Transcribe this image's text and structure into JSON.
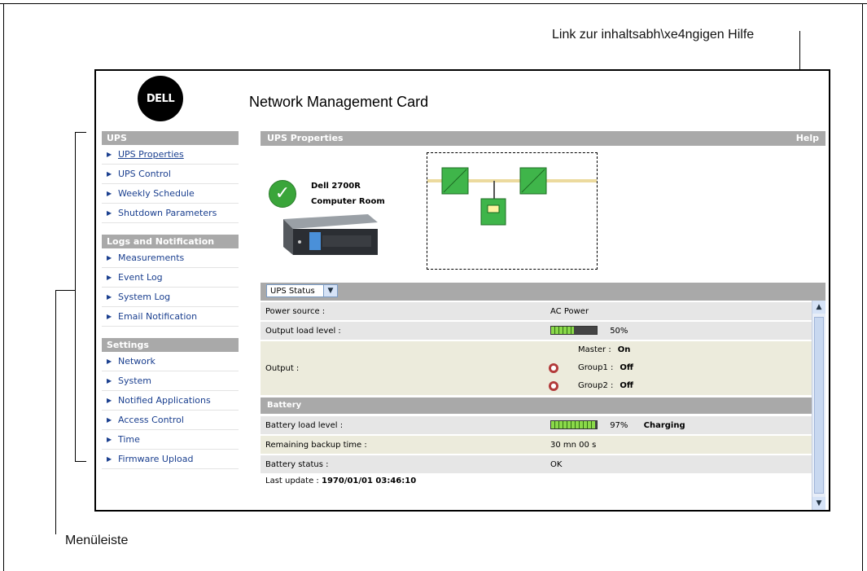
{
  "callouts": {
    "help_link": "Link zur inhaltsabh\\xe4ngigen Hilfe",
    "menu_bar": "Menüleiste"
  },
  "logo_text": "DELL",
  "header": {
    "title": "Network Management Card"
  },
  "sidebar": {
    "sections": [
      {
        "title": "UPS",
        "items": [
          "UPS Properties",
          "UPS Control",
          "Weekly Schedule",
          "Shutdown Parameters"
        ]
      },
      {
        "title": "Logs and Notification",
        "items": [
          "Measurements",
          "Event Log",
          "System Log",
          "Email Notification"
        ]
      },
      {
        "title": "Settings",
        "items": [
          "Network",
          "System",
          "Notified Applications",
          "Access Control",
          "Time",
          "Firmware Upload"
        ]
      }
    ]
  },
  "properties": {
    "title": "UPS Properties",
    "help": "Help",
    "ups_model": "Dell 2700R",
    "ups_location": "Computer Room"
  },
  "status": {
    "select_value": "UPS Status",
    "rows": [
      {
        "label": "Power source :",
        "value": "AC Power"
      },
      {
        "label": "Output load level :",
        "value": "50%",
        "level": 0.5
      },
      {
        "label": "Output :"
      }
    ],
    "outputs": [
      {
        "name": "Master :",
        "state": "On"
      },
      {
        "name": "Group1 :",
        "state": "Off"
      },
      {
        "name": "Group2 :",
        "state": "Off"
      }
    ],
    "battery_title": "Battery",
    "battery_rows": [
      {
        "label": "Battery load level :",
        "value": "97%",
        "level": 0.97,
        "extra": "Charging"
      },
      {
        "label": "Remaining backup time :",
        "value": "30 mn 00 s"
      },
      {
        "label": "Battery status :",
        "value": "OK"
      }
    ],
    "last_update_label": "Last update :",
    "last_update_value": "1970/01/01 03:46:10"
  },
  "colors": {
    "section_bar": "#a9a9a9",
    "link": "#1a3f8f",
    "power_line": "#e8c84a",
    "module_green": "#3fb54a"
  }
}
